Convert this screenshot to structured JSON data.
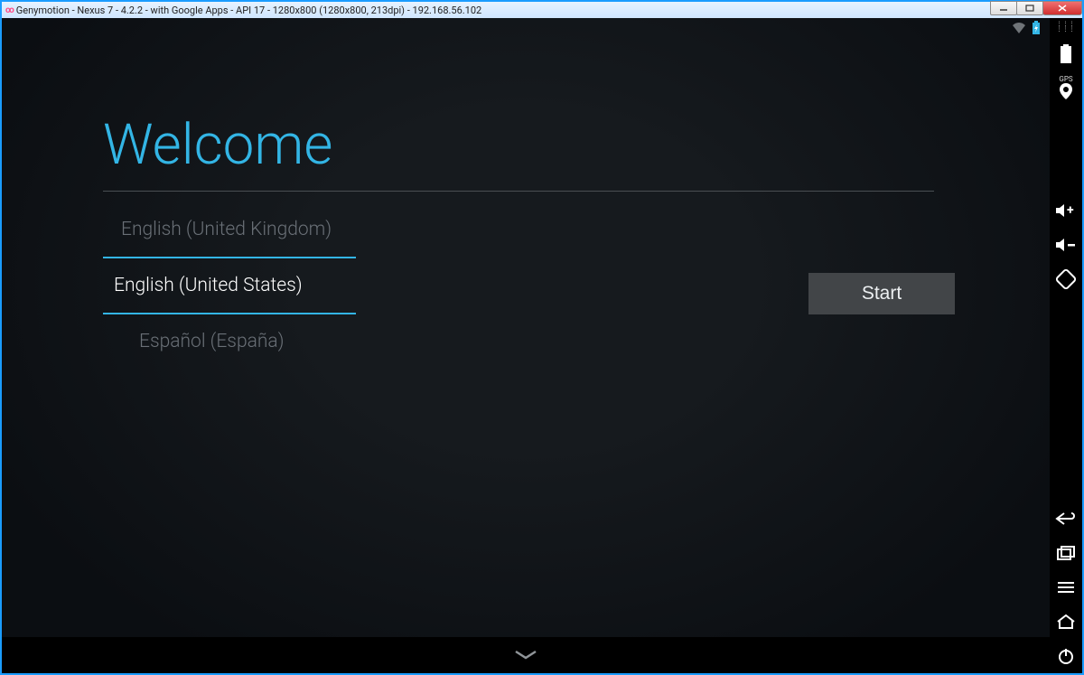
{
  "window": {
    "title": "Genymotion - Nexus 7 - 4.2.2 - with Google Apps - API 17 - 1280x800 (1280x800, 213dpi) - 192.168.56.102"
  },
  "welcome": {
    "title": "Welcome",
    "languages": {
      "above": "English (United Kingdom)",
      "selected": "English (United States)",
      "below": "Español (España)"
    },
    "start_label": "Start"
  },
  "genymotion_sidebar": {
    "gps_label": "GPS"
  }
}
